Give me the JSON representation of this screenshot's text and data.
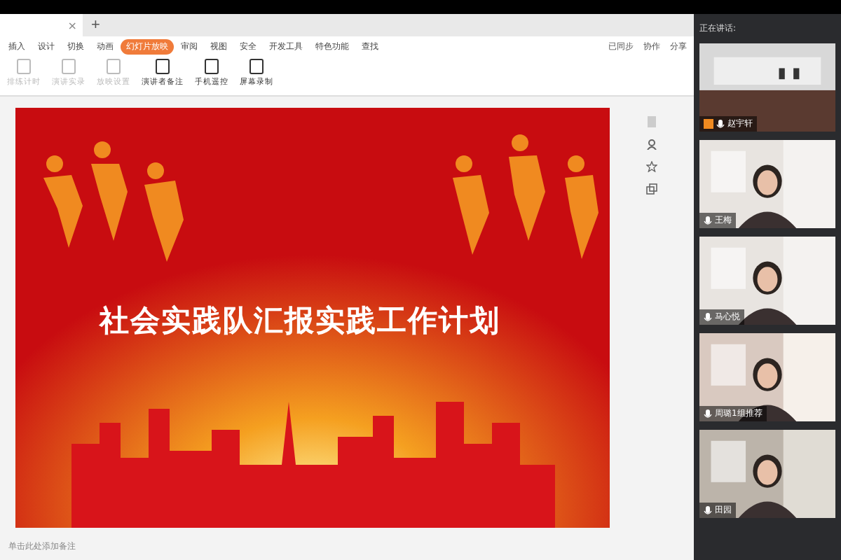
{
  "tabs": {
    "close": "×",
    "new": "+"
  },
  "menu": [
    {
      "label": "插入",
      "selected": false
    },
    {
      "label": "设计",
      "selected": false
    },
    {
      "label": "切换",
      "selected": false
    },
    {
      "label": "动画",
      "selected": false
    },
    {
      "label": "幻灯片放映",
      "selected": true
    },
    {
      "label": "审阅",
      "selected": false
    },
    {
      "label": "视图",
      "selected": false
    },
    {
      "label": "安全",
      "selected": false
    },
    {
      "label": "开发工具",
      "selected": false
    },
    {
      "label": "特色功能",
      "selected": false
    },
    {
      "label": "查找",
      "selected": false
    }
  ],
  "actions": [
    {
      "label": "已同步"
    },
    {
      "label": "协作"
    },
    {
      "label": "分享"
    }
  ],
  "tools": [
    {
      "label": "排练计时",
      "disabled": true
    },
    {
      "label": "演讲实录",
      "disabled": true
    },
    {
      "label": "放映设置",
      "disabled": true
    },
    {
      "label": "演讲者备注",
      "disabled": false
    },
    {
      "label": "手机遥控",
      "disabled": false
    },
    {
      "label": "屏幕录制",
      "disabled": false
    }
  ],
  "slide": {
    "title": "社会实践队汇报实践工作计划"
  },
  "notes": {
    "placeholder": "单击此处添加备注"
  },
  "panel": {
    "title": "正在讲话:",
    "participants": [
      {
        "name": "赵宇轩",
        "host": true
      },
      {
        "name": "王梅",
        "host": false
      },
      {
        "name": "马心悦",
        "host": false
      },
      {
        "name": "周璐1组推荐",
        "host": false
      },
      {
        "name": "田园",
        "host": false
      }
    ]
  }
}
